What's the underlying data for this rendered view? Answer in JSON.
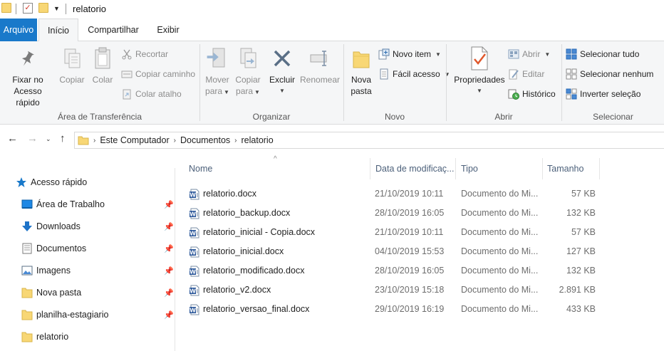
{
  "window": {
    "title": "relatorio"
  },
  "ribbon_tabs": {
    "arquivo": "Arquivo",
    "inicio": "Início",
    "compartilhar": "Compartilhar",
    "exibir": "Exibir"
  },
  "clipboard": {
    "pin_line1": "Fixar no",
    "pin_line2": "Acesso rápido",
    "copy": "Copiar",
    "paste": "Colar",
    "cut": "Recortar",
    "copy_path": "Copiar caminho",
    "paste_shortcut": "Colar atalho",
    "label": "Área de Transferência"
  },
  "organize": {
    "move_line1": "Mover",
    "move_line2": "para",
    "copy_to_line1": "Copiar",
    "copy_to_line2": "para",
    "delete": "Excluir",
    "rename": "Renomear",
    "label": "Organizar"
  },
  "new": {
    "new_folder_line1": "Nova",
    "new_folder_line2": "pasta",
    "new_item": "Novo item",
    "easy_access": "Fácil acesso",
    "label": "Novo"
  },
  "open": {
    "properties": "Propriedades",
    "open": "Abrir",
    "edit": "Editar",
    "history": "Histórico",
    "label": "Abrir"
  },
  "select": {
    "select_all": "Selecionar tudo",
    "select_none": "Selecionar nenhum",
    "invert": "Inverter seleção",
    "label": "Selecionar"
  },
  "address": {
    "crumbs": [
      "Este Computador",
      "Documentos",
      "relatorio"
    ]
  },
  "nav_pane": {
    "quick_access": "Acesso rápido",
    "items": [
      {
        "label": "Área de Trabalho",
        "pinned": true,
        "icon": "desktop-icon"
      },
      {
        "label": "Downloads",
        "pinned": true,
        "icon": "download-icon"
      },
      {
        "label": "Documentos",
        "pinned": true,
        "icon": "documents-icon"
      },
      {
        "label": "Imagens",
        "pinned": true,
        "icon": "pictures-icon"
      },
      {
        "label": "Nova pasta",
        "pinned": true,
        "icon": "folder-icon"
      },
      {
        "label": "planilha-estagiario",
        "pinned": true,
        "icon": "folder-icon"
      },
      {
        "label": "relatorio",
        "pinned": false,
        "icon": "folder-icon"
      }
    ]
  },
  "file_list": {
    "columns": {
      "name": "Nome",
      "date": "Data de modificaç...",
      "type": "Tipo",
      "size": "Tamanho"
    },
    "rows": [
      {
        "name": "relatorio.docx",
        "date": "21/10/2019 10:11",
        "type": "Documento do Mi...",
        "size": "57 KB"
      },
      {
        "name": "relatorio_backup.docx",
        "date": "28/10/2019 16:05",
        "type": "Documento do Mi...",
        "size": "132 KB"
      },
      {
        "name": "relatorio_inicial - Copia.docx",
        "date": "21/10/2019 10:11",
        "type": "Documento do Mi...",
        "size": "57 KB"
      },
      {
        "name": "relatorio_inicial.docx",
        "date": "04/10/2019 15:53",
        "type": "Documento do Mi...",
        "size": "127 KB"
      },
      {
        "name": "relatorio_modificado.docx",
        "date": "28/10/2019 16:05",
        "type": "Documento do Mi...",
        "size": "132 KB"
      },
      {
        "name": "relatorio_v2.docx",
        "date": "23/10/2019 15:18",
        "type": "Documento do Mi...",
        "size": "2.891 KB"
      },
      {
        "name": "relatorio_versao_final.docx",
        "date": "29/10/2019 16:19",
        "type": "Documento do Mi...",
        "size": "433 KB"
      }
    ]
  },
  "colors": {
    "accent": "#1979ca",
    "folder": "#f8d775",
    "word": "#2b579a"
  }
}
